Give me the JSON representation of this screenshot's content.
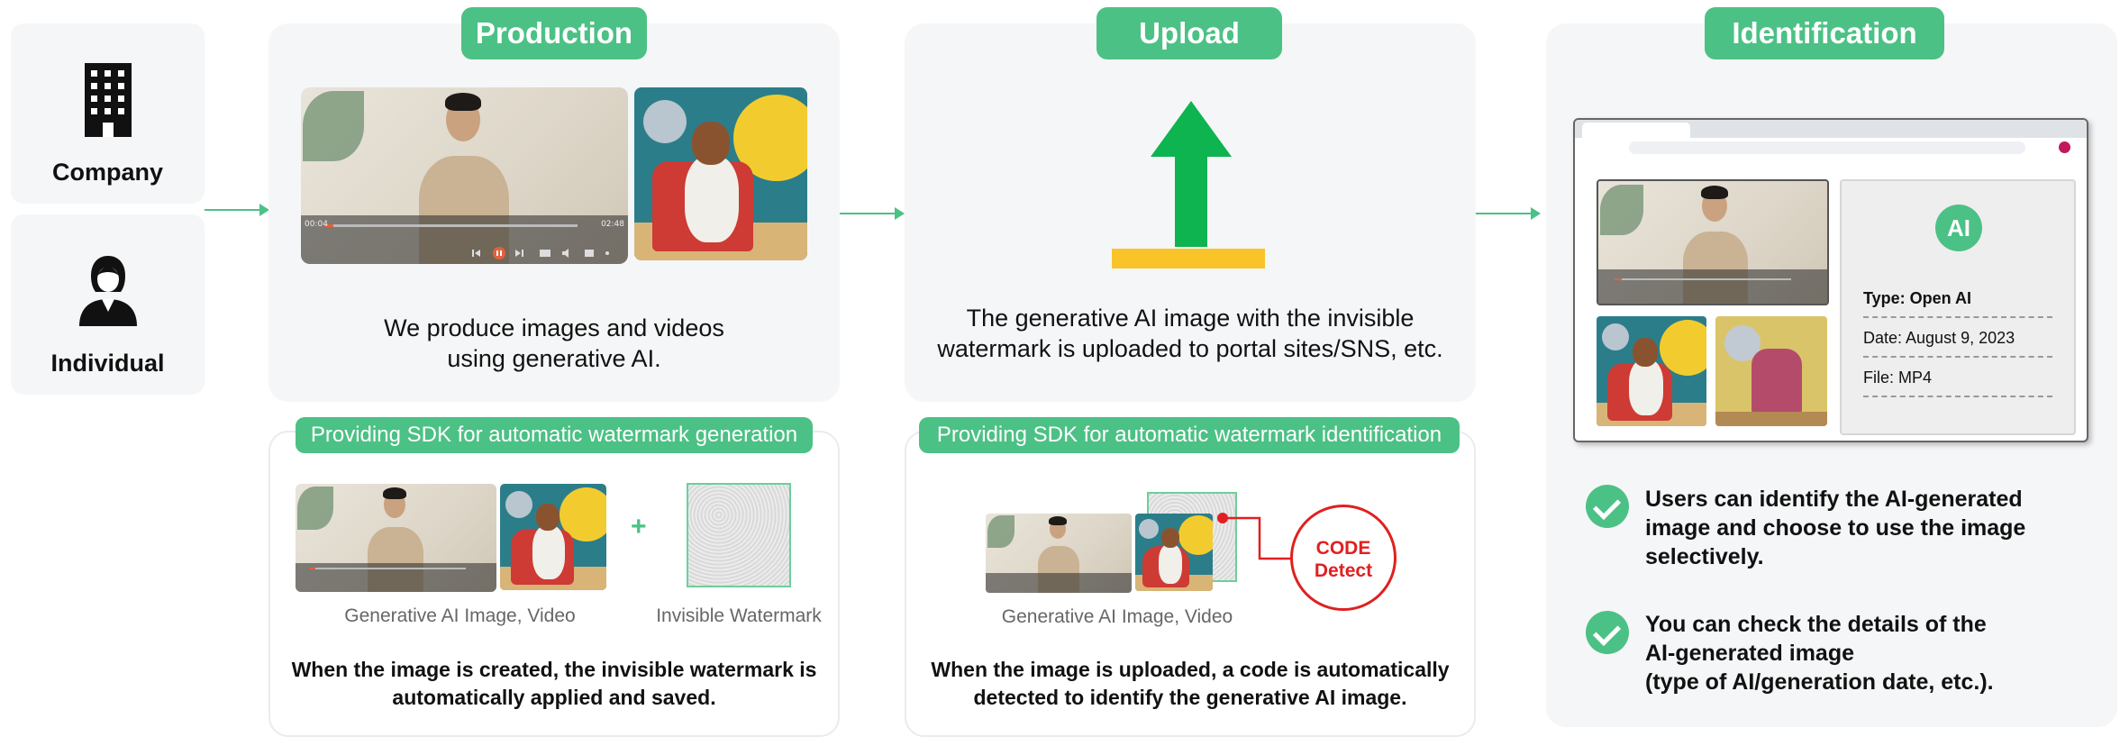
{
  "left": {
    "company_label": "Company",
    "individual_label": "Individual",
    "company_icon": "building-icon",
    "individual_icon": "person-icon"
  },
  "production": {
    "title": "Production",
    "description_line1": "We produce images and videos",
    "description_line2": "using generative AI.",
    "video_time_start": "00:04",
    "video_time_end": "02:48"
  },
  "upload": {
    "title": "Upload",
    "description_line1": "The generative AI image with the invisible",
    "description_line2": "watermark is uploaded to portal sites/SNS, etc.",
    "icon": "upload-arrow-icon"
  },
  "identification": {
    "title": "Identification",
    "ai_badge": "AI",
    "info_type": "Type: Open AI",
    "info_date": "Date: August 9, 2023",
    "info_file": "File: MP4",
    "point1_line1": "Users can identify the AI-generated",
    "point1_line2": "image and choose to use the image",
    "point1_line3": "selectively.",
    "point2_line1": "You can check the details of the",
    "point2_line2": "AI-generated image",
    "point2_line3": "(type of AI/generation date, etc.)."
  },
  "sdk_generation": {
    "label": "Providing SDK for automatic watermark generation",
    "plus": "+",
    "caption_media": "Generative AI Image, Video",
    "caption_watermark": "Invisible Watermark",
    "summary_line1": "When the image is created, the invisible watermark is",
    "summary_line2": "automatically applied and saved."
  },
  "sdk_identification": {
    "label": "Providing SDK for automatic watermark identification",
    "detect_line1": "CODE",
    "detect_line2": "Detect",
    "caption_media": "Generative AI Image, Video",
    "summary_line1": "When the image is uploaded, a code is automatically",
    "summary_line2": "detected to identify the generative AI image."
  },
  "colors": {
    "accent_green": "#4cc185",
    "upload_arrow": "#0db44f",
    "upload_base": "#f9c42a",
    "detect_red": "#e02020"
  }
}
